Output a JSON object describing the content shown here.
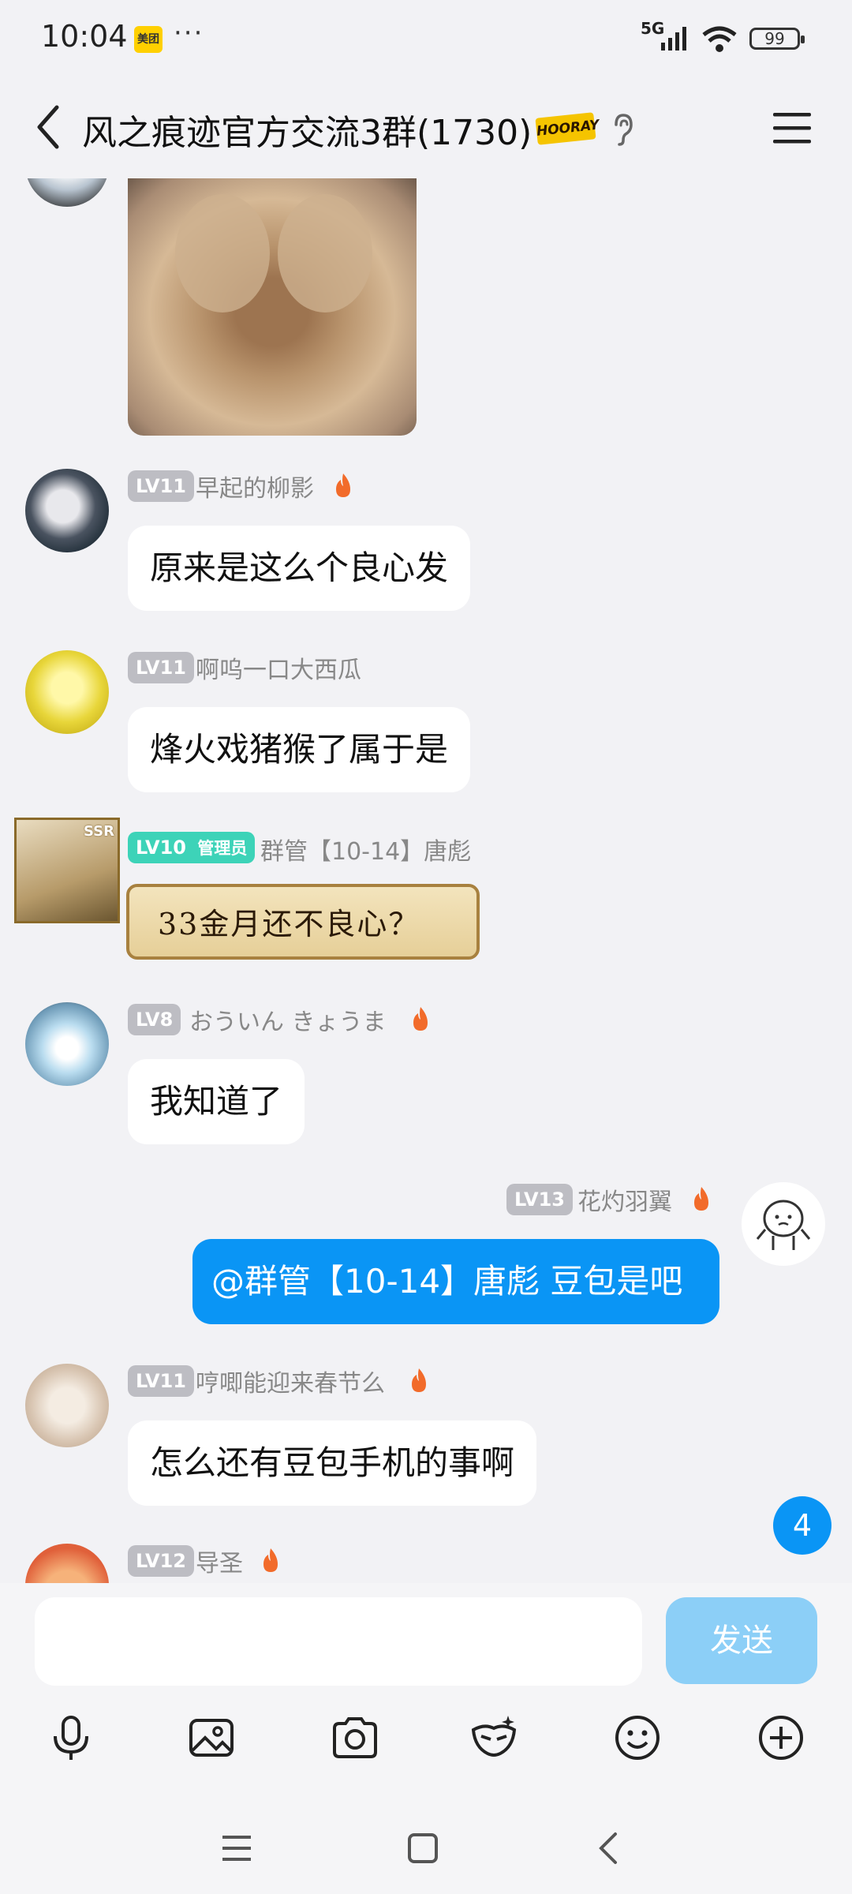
{
  "status_bar": {
    "time": "10:04",
    "app_badge": "美团",
    "dots": "···",
    "network": "5G",
    "battery": "99"
  },
  "header": {
    "title": "风之痕迹官方交流3群(1730)",
    "badge": "HOORAY"
  },
  "messages": [
    {
      "level": "LV11",
      "nickname": "早起的柳影",
      "text": "原来是这么个良心发"
    },
    {
      "level": "LV11",
      "nickname": "啊呜一口大西瓜",
      "text": "烽火戏猪猴了属于是"
    },
    {
      "level": "LV10",
      "role": "管理员",
      "nickname": "群管【10-14】唐彪",
      "sticker_text": "33金月还不良心？",
      "avatar_tag": "SSR"
    },
    {
      "level": "LV8",
      "nickname": "おういん きょうま",
      "text": "我知道了"
    },
    {
      "level": "LV13",
      "nickname": "花灼羽翼",
      "text": "@群管【10-14】唐彪 豆包是吧"
    },
    {
      "level": "LV11",
      "nickname": "哼唧能迎来春节么",
      "text": "怎么还有豆包手机的事啊"
    },
    {
      "level": "LV12",
      "nickname": "导圣"
    }
  ],
  "unread_count": "4",
  "composer": {
    "placeholder": "",
    "send_label": "发送"
  },
  "toolbar_icons": [
    "microphone-icon",
    "image-icon",
    "camera-icon",
    "hongbao-mask-icon",
    "emoji-icon",
    "plus-icon"
  ],
  "colors": {
    "accent": "#0a95f5",
    "send_disabled": "#8ccff7",
    "admin_badge": "#3dd3b8",
    "level_badge": "#bdbdc3",
    "background": "#f2f2f5"
  }
}
